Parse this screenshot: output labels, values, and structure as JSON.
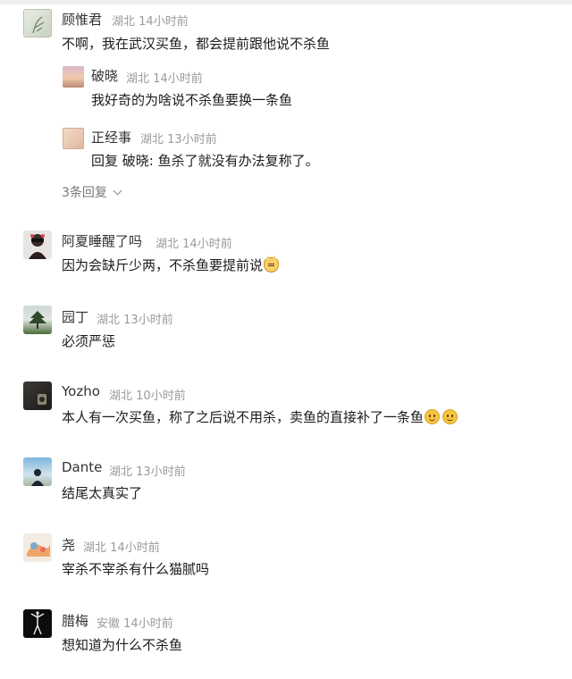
{
  "comments": [
    {
      "user": "顾惟君",
      "location": "湖北",
      "time": "14小时前",
      "text": "不啊，我在武汉买鱼，都会提前跟他说不杀鱼",
      "avatar_icon": "sketch-illustration-avatar",
      "replies": [
        {
          "user": "破晓",
          "location": "湖北",
          "time": "14小时前",
          "text": "我好奇的为啥说不杀鱼要换一条鱼",
          "avatar_icon": "sunset-sky-avatar"
        },
        {
          "user": "正经事",
          "location": "湖北",
          "time": "13小时前",
          "text": "回复 破晓: 鱼杀了就没有办法复称了。",
          "avatar_icon": "hands-avatar"
        }
      ],
      "replies_toggle": "3条回复"
    },
    {
      "user": "阿夏睡醒了吗",
      "location": "湖北",
      "time": "14小时前",
      "text": "因为会缺斤少两，不杀鱼要提前说",
      "avatar_icon": "person-sunglasses-avatar",
      "emoji": "cat-emoji"
    },
    {
      "user": "园丁",
      "location": "湖北",
      "time": "13小时前",
      "text": "必须严惩",
      "avatar_icon": "tree-landscape-avatar"
    },
    {
      "user": "Yozho",
      "location": "湖北",
      "time": "10小时前",
      "text": "本人有一次买鱼，称了之后说不用杀，卖鱼的直接补了一条鱼",
      "avatar_icon": "dark-photo-avatar",
      "emoji": "smile-emoji"
    },
    {
      "user": "Dante",
      "location": "湖北",
      "time": "13小时前",
      "text": "结尾太真实了",
      "avatar_icon": "silhouette-sky-avatar"
    },
    {
      "user": "尧",
      "location": "湖北",
      "time": "14小时前",
      "text": "宰杀不宰杀有什么猫腻吗",
      "avatar_icon": "colorful-art-avatar"
    },
    {
      "user": "腊梅",
      "location": "安徽",
      "time": "14小时前",
      "text": "想知道为什么不杀鱼",
      "avatar_icon": "dancer-silhouette-avatar"
    }
  ],
  "colors": {
    "username": "#333333",
    "meta": "#9a9a9a",
    "text": "#1c1c1c",
    "background": "#ffffff"
  }
}
